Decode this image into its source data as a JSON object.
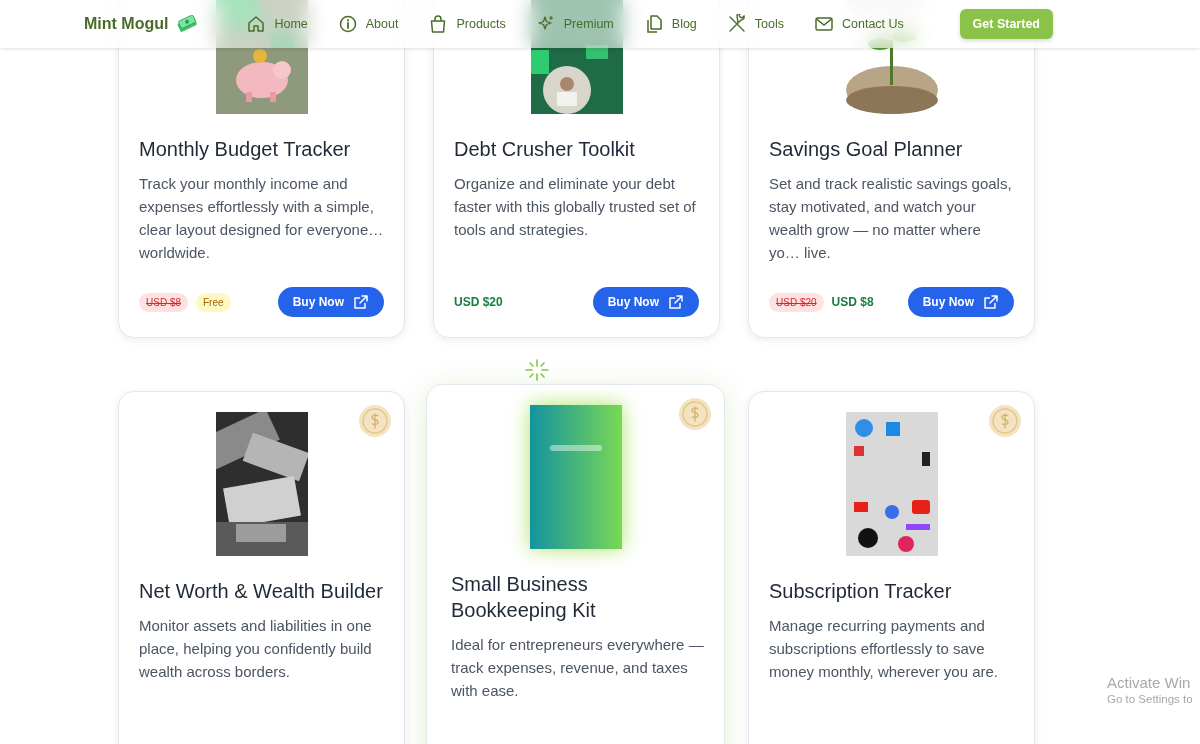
{
  "navbar": {
    "brand": "Mint Mogul",
    "links": [
      {
        "label": "Home"
      },
      {
        "label": "About"
      },
      {
        "label": "Products"
      },
      {
        "label": "Premium"
      },
      {
        "label": "Blog"
      },
      {
        "label": "Tools"
      },
      {
        "label": "Contact Us"
      }
    ],
    "cta": "Get Started"
  },
  "product_rows": [
    {
      "cards": [
        {
          "title": "Monthly Budget Tracker",
          "description": "Track your monthly income and expenses effortlessly with a simple, clear layout designed for everyone… worldwide.",
          "prices": [
            {
              "text": "USD $8",
              "kind": "old"
            },
            {
              "text": "Free",
              "kind": "free"
            }
          ],
          "button": "Buy Now",
          "highlighted": false
        },
        {
          "title": "Debt Crusher Toolkit",
          "description": "Organize and eliminate your debt faster with this globally trusted set of tools and strategies.",
          "prices": [
            {
              "text": "USD $20",
              "kind": "current"
            }
          ],
          "button": "Buy Now",
          "highlighted": false
        },
        {
          "title": "Savings Goal Planner",
          "description": "Set and track realistic savings goals, stay motivated, and watch your wealth grow — no matter where yo… live.",
          "prices": [
            {
              "text": "USD $20",
              "kind": "old"
            },
            {
              "text": "USD $8",
              "kind": "current"
            }
          ],
          "button": "Buy Now",
          "highlighted": false
        }
      ]
    },
    {
      "cards": [
        {
          "title": "Net Worth & Wealth Builder",
          "description": "Monitor assets and liabilities in one place, helping you confidently build wealth across borders.",
          "coin": true,
          "highlighted": false
        },
        {
          "title": "Small Business Bookkeeping Kit",
          "description": "Ideal for entrepreneurs everywhere — track expenses, revenue, and taxes with ease.",
          "coin": true,
          "highlighted": true
        },
        {
          "title": "Subscription Tracker",
          "description": "Manage recurring payments and subscriptions effortlessly to save money monthly, wherever you are.",
          "coin": true,
          "highlighted": false
        }
      ]
    }
  ],
  "os_notice": {
    "title": "Activate Win",
    "subtitle": "Go to Settings to"
  }
}
